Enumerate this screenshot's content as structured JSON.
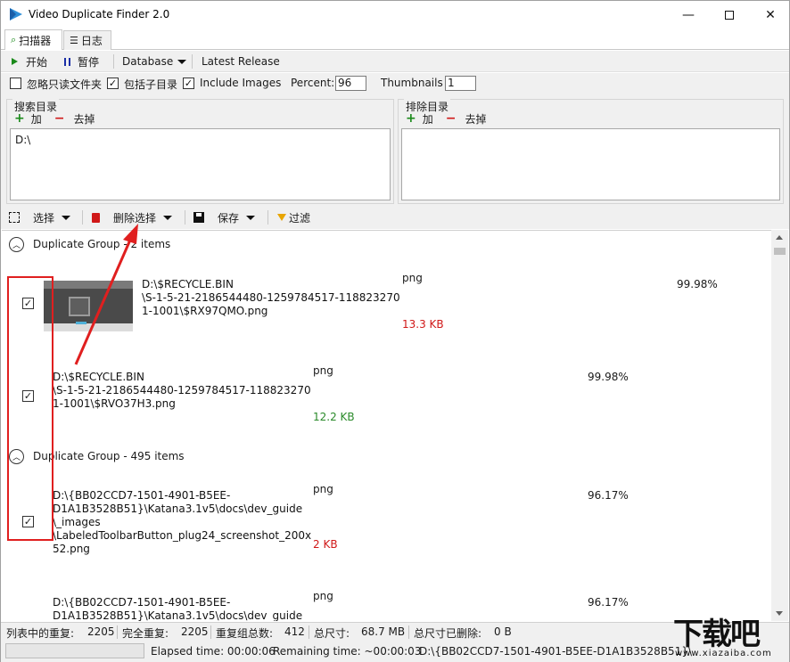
{
  "window": {
    "title": "Video Duplicate Finder 2.0"
  },
  "tabs": [
    {
      "label": "扫描器",
      "icon": "scanner-icon"
    },
    {
      "label": "日志",
      "icon": "list-icon"
    }
  ],
  "toolbar": {
    "start_label": "开始",
    "pause_label": "暂停",
    "database_label": "Database",
    "latest_release_label": "Latest Release"
  },
  "options": {
    "ignore_readonly": {
      "label": "忽略只读文件夹",
      "checked": false
    },
    "include_subdirs": {
      "label": "包括子目录",
      "checked": true
    },
    "include_images": {
      "label": "Include Images",
      "checked": true
    },
    "percent_label": "Percent:",
    "percent_value": "96",
    "thumbnails_label": "Thumbnails",
    "thumbnails_value": "1"
  },
  "search_dirs": {
    "title": "搜索目录",
    "add_label": "加",
    "remove_label": "去掉",
    "items": [
      "D:\\"
    ]
  },
  "exclude_dirs": {
    "title": "排除目录",
    "add_label": "加",
    "remove_label": "去掉"
  },
  "results_toolbar": {
    "select_label": "选择",
    "delete_label": "删除选择",
    "save_label": "保存",
    "filter_label": "过滤"
  },
  "groups": [
    {
      "header": "Duplicate Group - 2 items",
      "items": [
        {
          "checked": true,
          "path": "D:\\$RECYCLE.BIN\n\\S-1-5-21-2186544480-1259784517-118823270\n1-1001\\$RX97QMO.png",
          "format": "png",
          "size": "13.3 KB",
          "size_color": "#d01818",
          "percent": "99.98%"
        },
        {
          "checked": true,
          "path": "D:\\$RECYCLE.BIN\n\\S-1-5-21-2186544480-1259784517-118823270\n1-1001\\$RVO37H3.png",
          "format": "png",
          "size": "12.2 KB",
          "size_color": "#2a8a2a",
          "percent": "99.98%"
        }
      ]
    },
    {
      "header": "Duplicate Group - 495 items",
      "items": [
        {
          "checked": true,
          "path": "D:\\{BB02CCD7-1501-4901-B5EE-\nD1A1B3528B51}\\Katana3.1v5\\docs\\dev_guide\n\\_images\n\\LabeledToolbarButton_plug24_screenshot_200x\n52.png",
          "format": "png",
          "size": "2 KB",
          "size_color": "#d01818",
          "percent": "96.17%"
        },
        {
          "checked": false,
          "path": "D:\\{BB02CCD7-1501-4901-B5EE-\nD1A1B3528B51}\\Katana3.1v5\\docs\\dev_guide",
          "format": "png",
          "size": "",
          "percent": "96.17%"
        }
      ]
    }
  ],
  "status": {
    "dupes_in_list_label": "列表中的重复:",
    "dupes_in_list_value": "2205",
    "full_dupes_label": "完全重复:",
    "full_dupes_value": "2205",
    "groups_label": "重复组总数:",
    "groups_value": "412",
    "total_size_label": "总尺寸:",
    "total_size_value": "68.7 MB",
    "deleted_size_label": "总尺寸已删除:",
    "deleted_size_value": "0 B",
    "elapsed": "Elapsed time: 00:00:06",
    "remaining": "Remaining time: ~00:00:03",
    "current_file": "D:\\{BB02CCD7-1501-4901-B5EE-D1A1B3528B51}\\"
  },
  "watermark": {
    "main": "下载吧",
    "sub": "www.xiazaiba.com"
  }
}
